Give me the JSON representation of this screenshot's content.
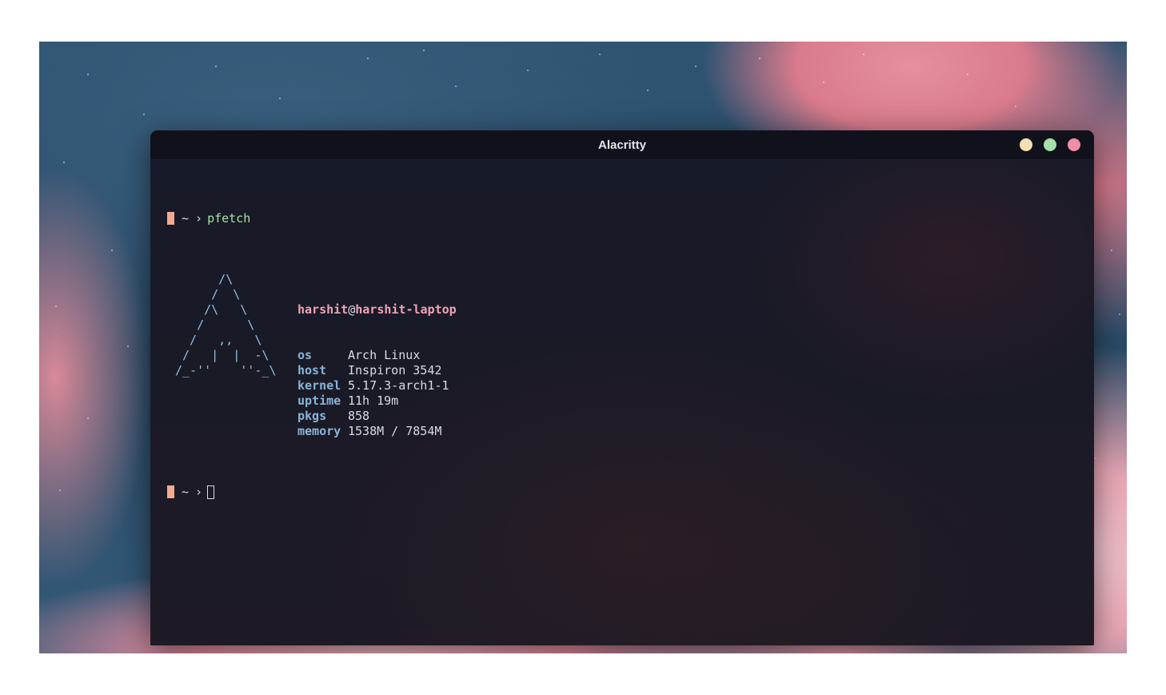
{
  "window": {
    "title": "Alacritty",
    "buttons": {
      "minimize_color": "#f5dfb0",
      "maximize_color": "#a6dfa8",
      "close_color": "#f08fa8"
    }
  },
  "prompt": {
    "cwd": "~",
    "symbol": "›",
    "command": "pfetch"
  },
  "pfetch": {
    "logo_lines": [
      "      /\\",
      "     /  \\",
      "    /\\   \\",
      "   /      \\",
      "  /   ,,   \\",
      " /   |  |  -\\",
      "/_-''    ''-_\\"
    ],
    "user": "harshit",
    "at": "@",
    "host_name": "harshit-laptop",
    "rows": [
      {
        "key": "os",
        "value": "Arch Linux"
      },
      {
        "key": "host",
        "value": "Inspiron 3542"
      },
      {
        "key": "kernel",
        "value": "5.17.3-arch1-1"
      },
      {
        "key": "uptime",
        "value": "11h 19m"
      },
      {
        "key": "pkgs",
        "value": "858"
      },
      {
        "key": "memory",
        "value": "1538M / 7854M"
      }
    ]
  },
  "colors": {
    "prompt_block": "#f5a98f",
    "command": "#a6e3a1",
    "logo": "#8fc0e0",
    "key": "#89b4d8",
    "user": "#f2a3b5"
  }
}
